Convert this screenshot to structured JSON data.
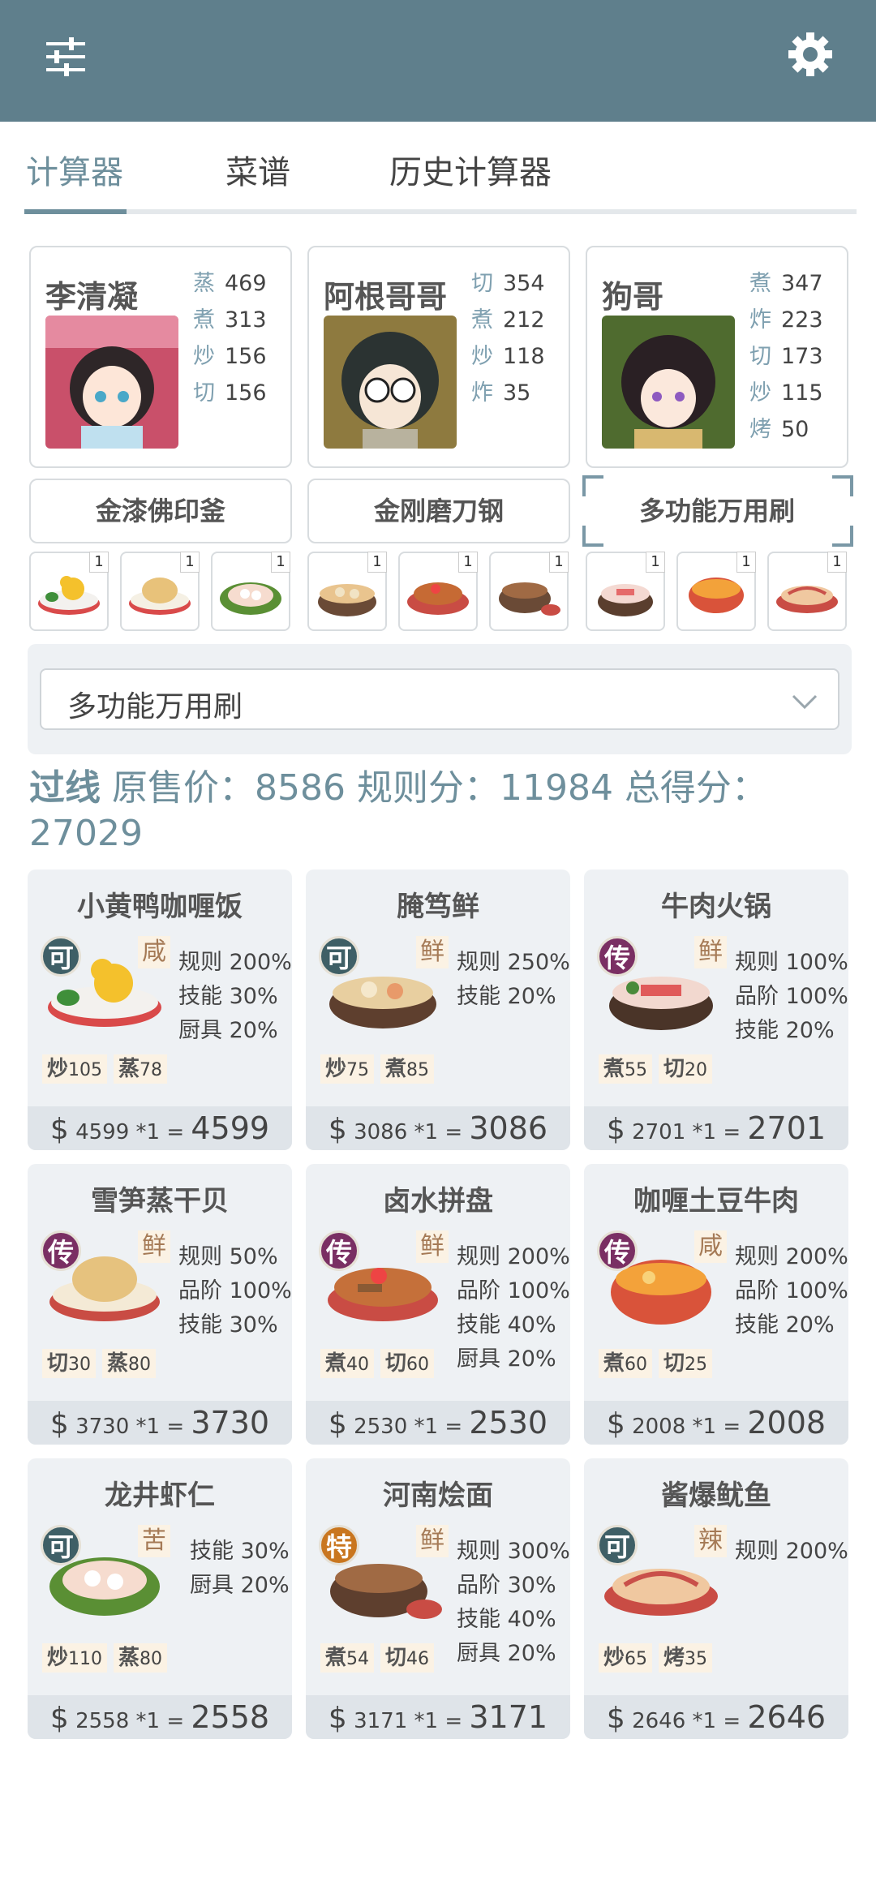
{
  "tabs": [
    {
      "label": "计算器",
      "active": true
    },
    {
      "label": "菜谱",
      "active": false
    },
    {
      "label": "历史计算器",
      "active": false
    }
  ],
  "chefs": [
    {
      "name": "李清凝",
      "stats": [
        [
          "蒸",
          "469"
        ],
        [
          "煮",
          "313"
        ],
        [
          "炒",
          "156"
        ],
        [
          "切",
          "156"
        ]
      ]
    },
    {
      "name": "阿根哥哥",
      "stats": [
        [
          "切",
          "354"
        ],
        [
          "煮",
          "212"
        ],
        [
          "炒",
          "118"
        ],
        [
          "炸",
          "35"
        ]
      ]
    },
    {
      "name": "狗哥",
      "stats": [
        [
          "煮",
          "347"
        ],
        [
          "炸",
          "223"
        ],
        [
          "切",
          "173"
        ],
        [
          "炒",
          "115"
        ],
        [
          "烤",
          "50"
        ]
      ]
    }
  ],
  "equipment": [
    "金漆佛印釜",
    "金刚磨刀钢",
    "多功能万用刷"
  ],
  "dish_counts": [
    "1",
    "1",
    "1",
    "1",
    "1",
    "1",
    "1",
    "1",
    "1"
  ],
  "selected_equipment": "多功能万用刷",
  "summary": {
    "pass": "过线",
    "text": "原售价：8586 规则分：11984 总得分：27029"
  },
  "recipes": [
    {
      "title": "小黄鸭咖喱饭",
      "rarity": "可",
      "flavor": "咸",
      "rules": [
        "规则 200%",
        "技能 30%",
        "厨具 20%"
      ],
      "needs": [
        [
          "炒",
          "105"
        ],
        [
          "蒸",
          "78"
        ]
      ],
      "price": "$",
      "base": "4599 *1",
      "eq": "=",
      "total": "4599"
    },
    {
      "title": "腌笃鲜",
      "rarity": "可",
      "flavor": "鲜",
      "rules": [
        "规则 250%",
        "技能 20%"
      ],
      "needs": [
        [
          "炒",
          "75"
        ],
        [
          "煮",
          "85"
        ]
      ],
      "price": "$",
      "base": "3086 *1",
      "eq": "=",
      "total": "3086"
    },
    {
      "title": "牛肉火锅",
      "rarity": "传",
      "flavor": "鲜",
      "rules": [
        "规则 100%",
        "品阶 100%",
        "技能 20%"
      ],
      "needs": [
        [
          "煮",
          "55"
        ],
        [
          "切",
          "20"
        ]
      ],
      "price": "$",
      "base": "2701 *1",
      "eq": "=",
      "total": "2701"
    },
    {
      "title": "雪笋蒸干贝",
      "rarity": "传",
      "flavor": "鲜",
      "rules": [
        "规则 50%",
        "品阶 100%",
        "技能 30%"
      ],
      "needs": [
        [
          "切",
          "30"
        ],
        [
          "蒸",
          "80"
        ]
      ],
      "price": "$",
      "base": "3730 *1",
      "eq": "=",
      "total": "3730"
    },
    {
      "title": "卤水拼盘",
      "rarity": "传",
      "flavor": "鲜",
      "rules": [
        "规则 200%",
        "品阶 100%",
        "技能 40%",
        "厨具 20%"
      ],
      "needs": [
        [
          "煮",
          "40"
        ],
        [
          "切",
          "60"
        ]
      ],
      "price": "$",
      "base": "2530 *1",
      "eq": "=",
      "total": "2530"
    },
    {
      "title": "咖喱土豆牛肉",
      "rarity": "传",
      "flavor": "咸",
      "rules": [
        "规则 200%",
        "品阶 100%",
        "技能 20%"
      ],
      "needs": [
        [
          "煮",
          "60"
        ],
        [
          "切",
          "25"
        ]
      ],
      "price": "$",
      "base": "2008 *1",
      "eq": "=",
      "total": "2008"
    },
    {
      "title": "龙井虾仁",
      "rarity": "可",
      "flavor": "苦",
      "rules": [
        "技能 30%",
        "厨具 20%"
      ],
      "needs": [
        [
          "炒",
          "110"
        ],
        [
          "蒸",
          "80"
        ]
      ],
      "price": "$",
      "base": "2558 *1",
      "eq": "=",
      "total": "2558"
    },
    {
      "title": "河南烩面",
      "rarity": "特",
      "flavor": "鲜",
      "rules": [
        "规则 300%",
        "品阶 30%",
        "技能 40%",
        "厨具 20%"
      ],
      "needs": [
        [
          "煮",
          "54"
        ],
        [
          "切",
          "46"
        ]
      ],
      "price": "$",
      "base": "3171 *1",
      "eq": "=",
      "total": "3171"
    },
    {
      "title": "酱爆鱿鱼",
      "rarity": "可",
      "flavor": "辣",
      "rules": [
        "规则 200%"
      ],
      "needs": [
        [
          "炒",
          "65"
        ],
        [
          "烤",
          "35"
        ]
      ],
      "price": "$",
      "base": "2646 *1",
      "eq": "=",
      "total": "2646"
    }
  ],
  "colors": {
    "header": "#5f7f8c",
    "accent": "#6e8f9c",
    "rarity_ke": "#3f5f66",
    "rarity_chuan": "#7a2f63",
    "rarity_te": "#c9761f"
  }
}
